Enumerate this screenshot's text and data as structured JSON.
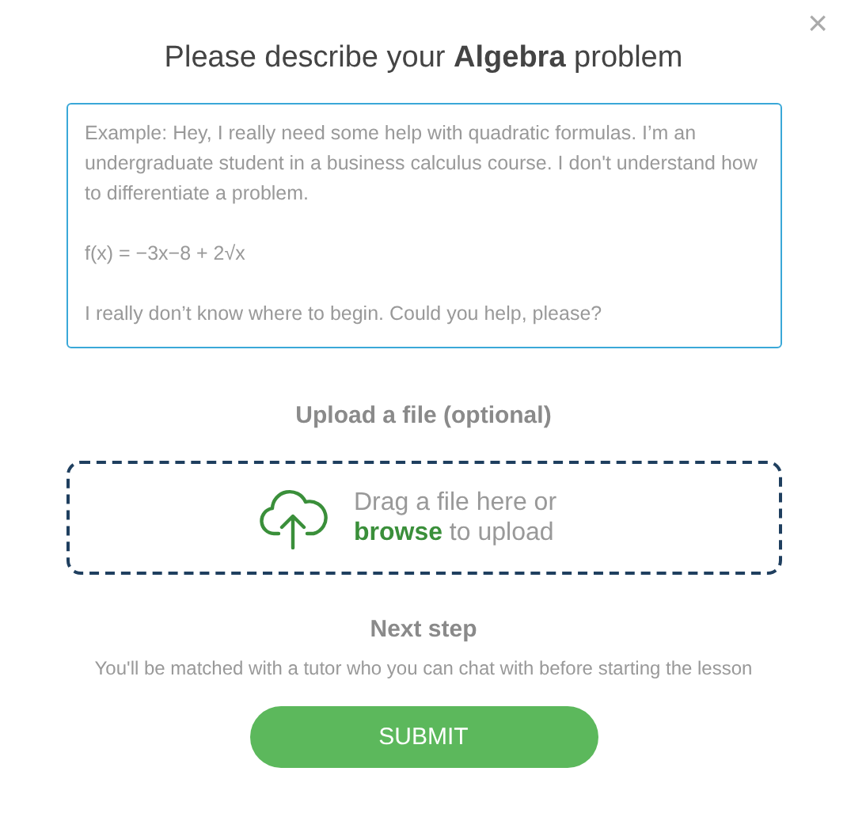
{
  "dialog": {
    "title": "Please describe your **Algebra** problem",
    "close": "×"
  },
  "problem_field": {
    "placeholder": "Example: Hey, I really need some help with quadratic formulas. I’m an undergraduate student in a business calculus course. I don't understand how to differentiate a problem.\n\nf(x) = −3x−8 + 2√x\n\nI really don’t know where to begin. Could you help, please?"
  },
  "upload": {
    "heading": "Upload a file (optional)",
    "text_before": "Drag a file here or",
    "link": "browse",
    "text_after": "to upload"
  },
  "next_step": {
    "heading": "Next step",
    "description": "You'll be matched with a tutor who you can chat with before starting the lesson"
  },
  "submit_button": {
    "label": "SUBMIT"
  }
}
